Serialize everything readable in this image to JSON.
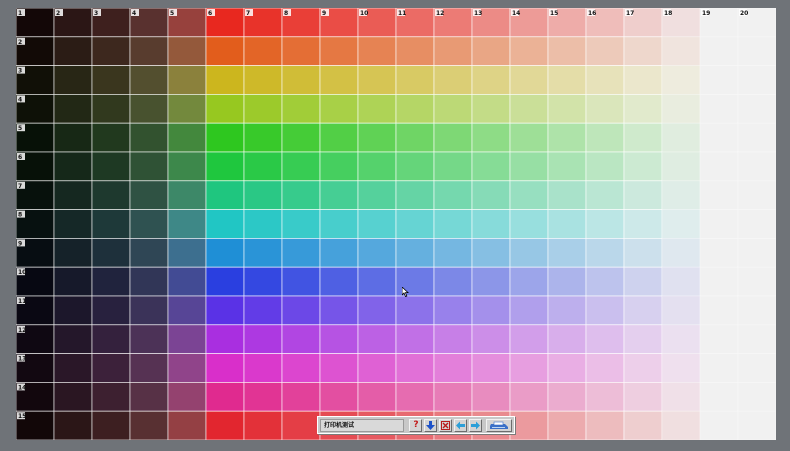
{
  "column_labels": [
    "1",
    "2",
    "3",
    "4",
    "5",
    "6",
    "7",
    "8",
    "9",
    "10",
    "11",
    "12",
    "13",
    "14",
    "15",
    "16",
    "17",
    "18",
    "19",
    "20"
  ],
  "row_labels": [
    "1",
    "2",
    "3",
    "4",
    "5",
    "6",
    "7",
    "8",
    "9",
    "10",
    "11",
    "12",
    "13",
    "14",
    "15"
  ],
  "row_hue_colors": [
    "#e8281f",
    "#e25d1c",
    "#ccb61e",
    "#97c820",
    "#2ec71f",
    "#1fc73e",
    "#1fc67f",
    "#21c6c4",
    "#1f8fd6",
    "#2a3fe0",
    "#5a32e6",
    "#a92fe0",
    "#d92fca",
    "#e02a8f",
    "#e2262f"
  ],
  "dark_column_colors": [
    "#050505",
    "#141414",
    "#1e1e1e",
    "#333333",
    "#555555"
  ],
  "light_end_color": "#f1f1f1",
  "toolbar": {
    "title": "打印机测试",
    "help_icon": "question-mark-icon",
    "down_icon": "down-arrow-icon",
    "close_icon": "close-icon",
    "left_icon": "left-arrow-icon",
    "right_icon": "right-arrow-icon",
    "print_icon": "printer-icon"
  }
}
